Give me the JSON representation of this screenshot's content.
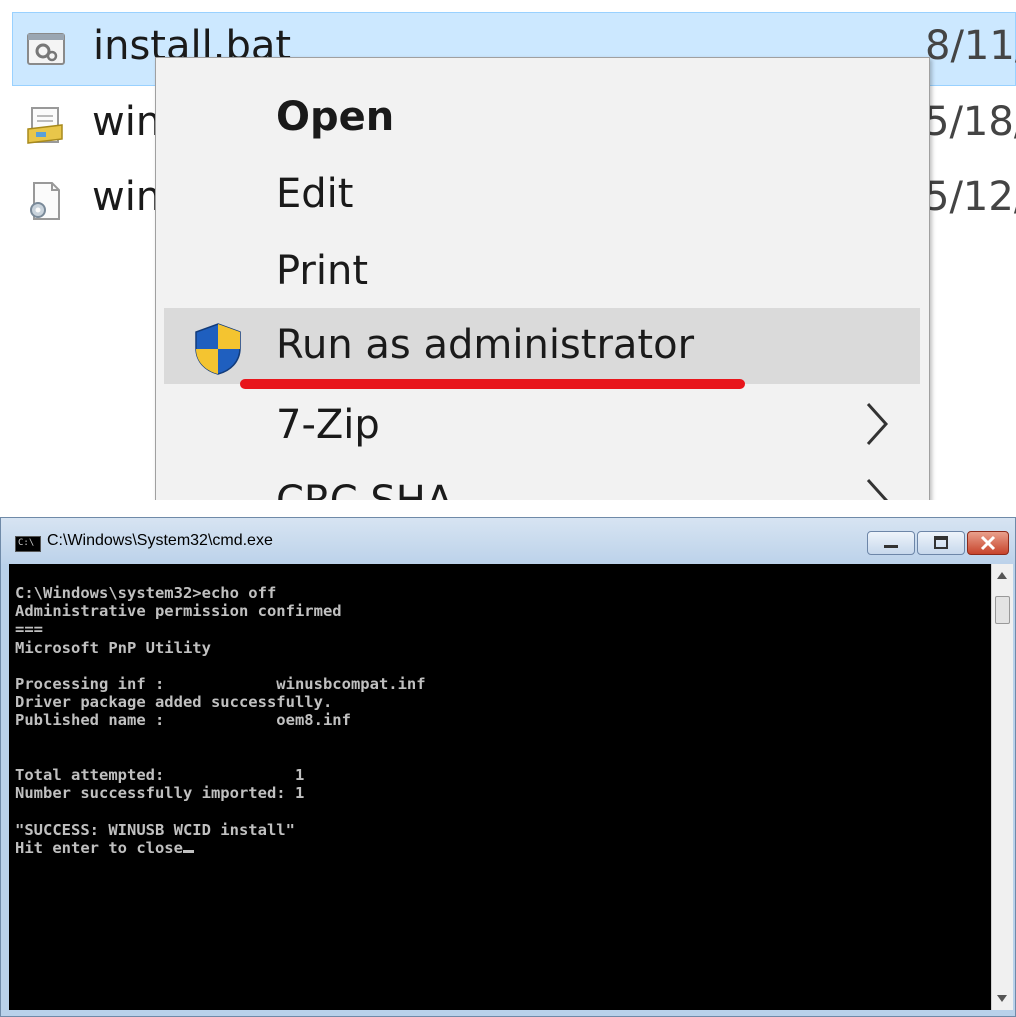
{
  "explorer": {
    "files": [
      {
        "name": "install.bat",
        "date": "8/11/"
      },
      {
        "name": "win",
        "date": "5/18/"
      },
      {
        "name": "win",
        "date": "5/12/"
      }
    ]
  },
  "context_menu": {
    "items": [
      {
        "label": "Open"
      },
      {
        "label": "Edit"
      },
      {
        "label": "Print"
      },
      {
        "label": "Run as administrator"
      },
      {
        "label": "7-Zip"
      },
      {
        "label": "CRC SHA"
      }
    ]
  },
  "cmd": {
    "title": "C:\\Windows\\System32\\cmd.exe",
    "icon_text": "C:\\",
    "output": "C:\\Windows\\system32>echo off\nAdministrative permission confirmed\n===\nMicrosoft PnP Utility\n\nProcessing inf :            winusbcompat.inf\nDriver package added successfully.\nPublished name :            oem8.inf\n\n\nTotal attempted:              1\nNumber successfully imported: 1\n\n\"SUCCESS: WINUSB WCID install\"\nHit enter to close"
  },
  "colors": {
    "selection": "#cce8ff",
    "highlight_underline": "#e8161c",
    "console_bg": "#000000",
    "console_text": "#c0c0c0"
  }
}
